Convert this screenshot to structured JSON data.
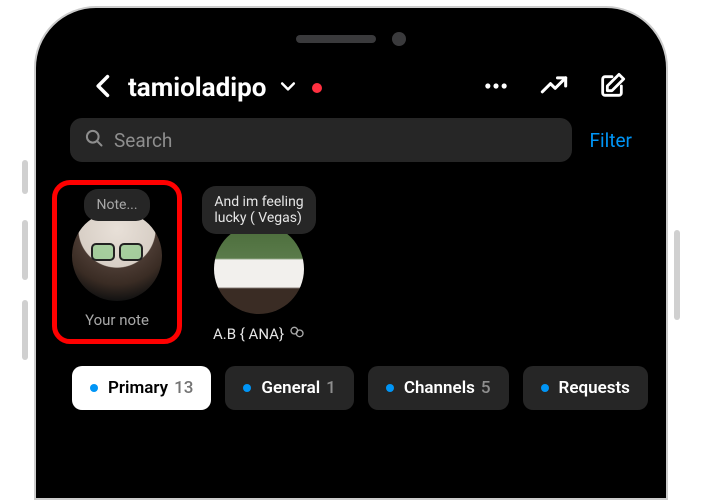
{
  "header": {
    "username": "tamioladipo"
  },
  "search": {
    "placeholder": "Search",
    "filter_label": "Filter"
  },
  "notes": [
    {
      "bubble": "Note...",
      "label": "Your note"
    },
    {
      "bubble": "And im feeling\nlucky ( Vegas)",
      "label": "A.B { ANA}"
    }
  ],
  "tabs": [
    {
      "label": "Primary",
      "count": "13",
      "active": true
    },
    {
      "label": "General",
      "count": "1",
      "active": false
    },
    {
      "label": "Channels",
      "count": "5",
      "active": false
    },
    {
      "label": "Requests",
      "count": "",
      "active": false
    }
  ],
  "colors": {
    "accent_blue": "#0095f6",
    "red_dot": "#ff3040",
    "highlight": "#ff0000"
  }
}
